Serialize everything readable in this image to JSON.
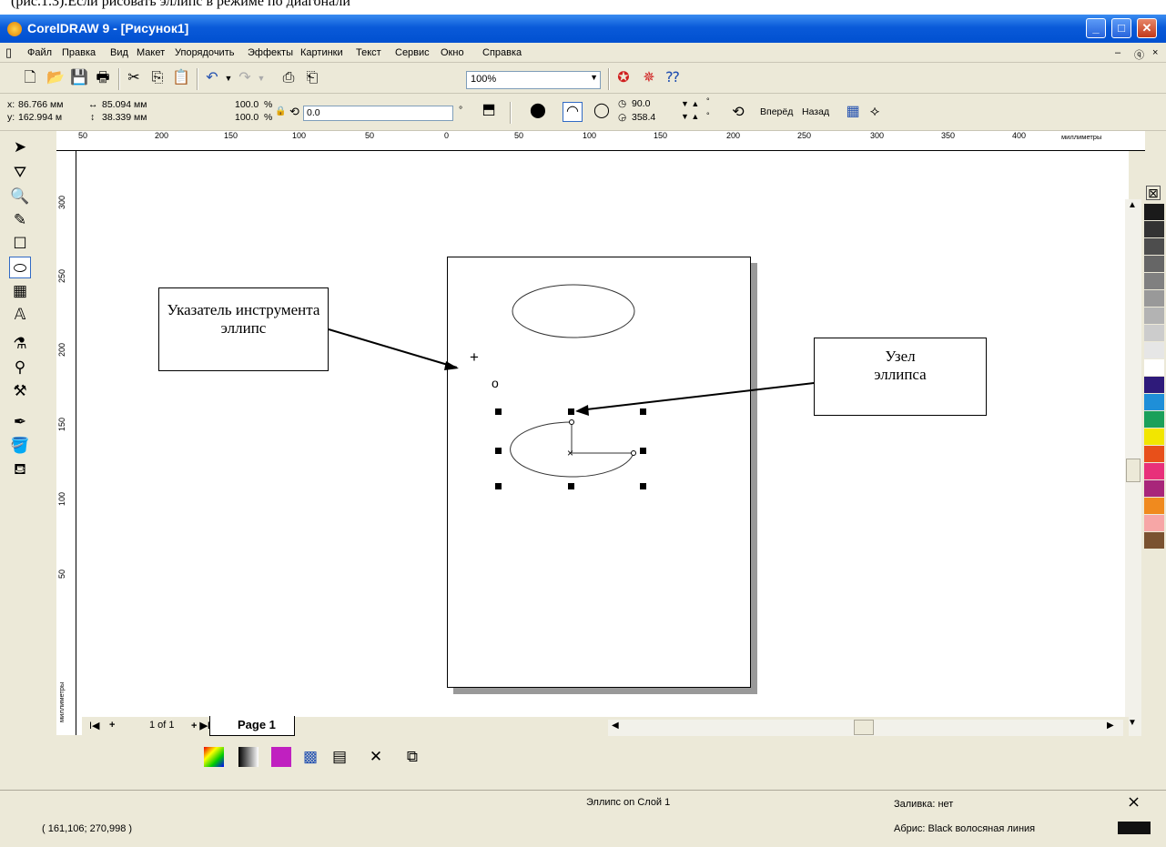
{
  "top_caption": "(рис.1.3).Если рисовать эллипс в режиме по диагонали",
  "window": {
    "title": "CorelDRAW 9 - [Рисунок1]",
    "controls": [
      "_",
      "□",
      "✕"
    ]
  },
  "menu": [
    "Файл",
    "Правка",
    "Вид",
    "Макет",
    "Упорядочить",
    "Эффекты",
    "Картинки",
    "Текст",
    "Сервис",
    "Окно",
    "Справка"
  ],
  "toolbar": {
    "zoom_value": "100%"
  },
  "property_bar": {
    "x_label": "x:",
    "x_value": "86.766 мм",
    "y_label": "y:",
    "y_value": "162.994 м",
    "width_value": "85.094 мм",
    "height_value": "38.339 мм",
    "scale_x": "100.0",
    "scale_y": "100.0",
    "percent": "%",
    "rotation_value": "0.0",
    "degree": "°",
    "start_angle": "90.0",
    "end_angle": "358.4",
    "forward_label": "Вперёд",
    "back_label": "Назад"
  },
  "rulers": {
    "top_ticks": [
      "50",
      "200",
      "150",
      "100",
      "50",
      "0",
      "50",
      "100",
      "150",
      "200",
      "250",
      "300",
      "350",
      "400"
    ],
    "top_unit": "миллиметры",
    "left_ticks": [
      "300",
      "250",
      "200",
      "150",
      "100",
      "50"
    ],
    "left_unit": "миллиметры"
  },
  "callouts": {
    "pointer_label": "Указатель инструмента эллипс",
    "node_label": "Узел эллипса"
  },
  "page_nav": {
    "counter": "1 of 1",
    "page_tab": "Page 1"
  },
  "palette_colors": [
    "#1a1a1a",
    "#333333",
    "#4d4d4d",
    "#666666",
    "#808080",
    "#999999",
    "#b3b3b3",
    "#cccccc",
    "#e6e6e6",
    "#ffffff",
    "#2e1a7a",
    "#1f8fd8",
    "#1aa05a",
    "#f2e600",
    "#e8501a",
    "#e8307a",
    "#a8267a",
    "#f08a1e",
    "#f7a6a6",
    "#7a5230"
  ],
  "status": {
    "object_info": "Эллипс on Слой 1",
    "coords": "( 161,106; 270,998 )",
    "fill_label": "Заливка: нет",
    "outline_label": "Абрис: Black  волосяная линия"
  }
}
